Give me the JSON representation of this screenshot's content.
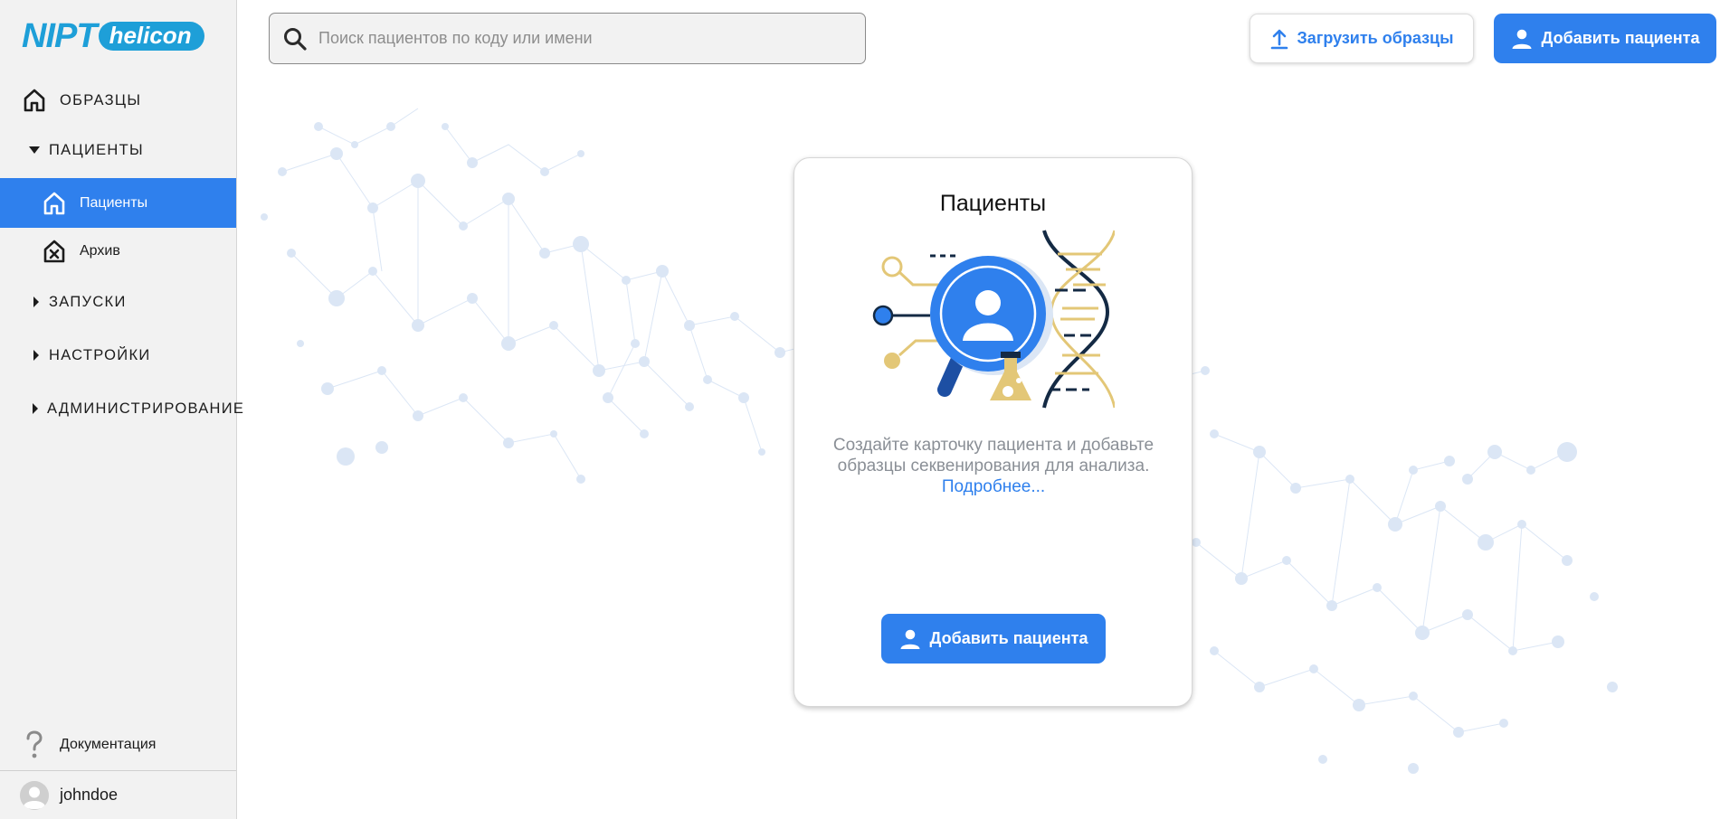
{
  "app": {
    "logo_main": "NIPT",
    "logo_badge": "helicon"
  },
  "sidebar": {
    "items": [
      {
        "label": "ОБРАЗЦЫ"
      },
      {
        "label": "ПАЦИЕНТЫ"
      },
      {
        "label": "Пациенты"
      },
      {
        "label": "Архив"
      },
      {
        "label": "ЗАПУСКИ"
      },
      {
        "label": "НАСТРОЙКИ"
      },
      {
        "label": "АДМИНИСТРИРОВАНИЕ"
      }
    ],
    "documentation": "Документация",
    "username": "johndoe"
  },
  "header": {
    "search_placeholder": "Поиск пациентов по коду или имени",
    "upload_label": "Загрузить образцы",
    "add_patient_label": "Добавить пациента"
  },
  "card": {
    "title": "Пациенты",
    "description": "Создайте карточку пациента и добавьте образцы секвенирования для анализа.",
    "link": "Подробнее...",
    "button_label": "Добавить пациента"
  },
  "colors": {
    "accent": "#2f80ed",
    "brand": "#1e9fd8",
    "sidebar_bg": "#f2f2f2",
    "illustration_gold": "#e3c777",
    "illustration_navy": "#142a44"
  }
}
